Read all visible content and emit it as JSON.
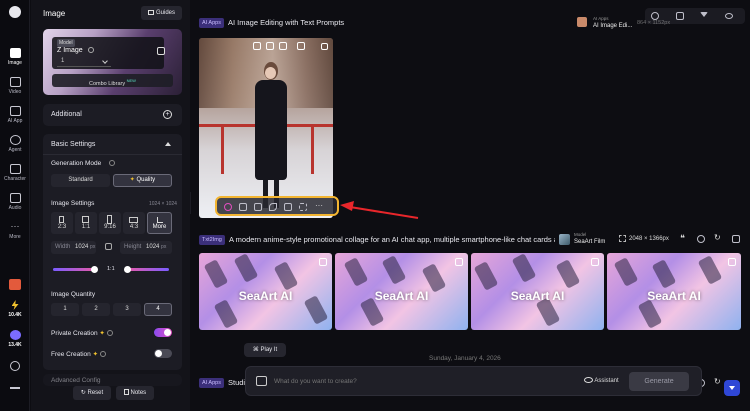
{
  "rail": {
    "items": [
      {
        "label": "Image",
        "active": true
      },
      {
        "label": "Video"
      },
      {
        "label": "AI App"
      },
      {
        "label": "Agent"
      },
      {
        "label": "Character"
      },
      {
        "label": "Audio"
      },
      {
        "label": "More"
      }
    ],
    "stat1": "10.4K",
    "stat2": "13.4K"
  },
  "panel": {
    "title": "Image",
    "guides_label": "Guides",
    "model_tag": "Model",
    "model_name": "Z Image",
    "model_count": "1",
    "combo_label": "Combo Library",
    "combo_badge": "NEW",
    "additional_label": "Additional",
    "basic_settings_label": "Basic Settings",
    "generation_mode_label": "Generation Mode",
    "modes": [
      "Standard",
      "Quality"
    ],
    "image_settings_label": "Image Settings",
    "image_settings_size": "1024 × 1024",
    "ratios": [
      "2:3",
      "1:1",
      "9:16",
      "4:3",
      "More"
    ],
    "width_label": "Width",
    "width_value": "1024",
    "height_label": "Height",
    "height_value": "1024",
    "unit": "px",
    "scale_label": "1:1",
    "quantity_label": "Image Quantity",
    "quantities": [
      "1",
      "2",
      "3",
      "4"
    ],
    "private_label": "Private Creation",
    "free_label": "Free Creation",
    "advanced_label": "Advanced Config",
    "reset_label": "Reset",
    "notes_label": "Notes"
  },
  "main": {
    "top_icons": [
      "search-icon",
      "grid-icon",
      "filter-icon",
      "eye-icon"
    ],
    "post1": {
      "tag": "AI Apps",
      "title": "AI Image Editing with Text Prompts",
      "app_caption": "AI Apps",
      "app_name": "AI Image Edi...",
      "size": "864 × 1152px"
    },
    "post2": {
      "tag": "Txt2Img",
      "title": "A modern anime-style promotional collage for an AI chat app, multiple smartphone-like chat cards a...",
      "model_caption": "Model",
      "model_name": "SeaArt Film",
      "size": "2048 × 1366px",
      "watermark": "SeaArt AI",
      "play_label": "Play It"
    },
    "date_divider": "Sunday, January 4, 2026",
    "post3": {
      "tag": "AI Apps",
      "title": "Studi"
    },
    "prompt_placeholder": "What do you want to create?",
    "assistant_label": "Assistant",
    "generate_label": "Generate",
    "colors": {
      "accent": "#7b5cff",
      "highlight": "#f3b531",
      "arrow": "#e8262b",
      "toggle_on": "#b44cf0"
    }
  }
}
